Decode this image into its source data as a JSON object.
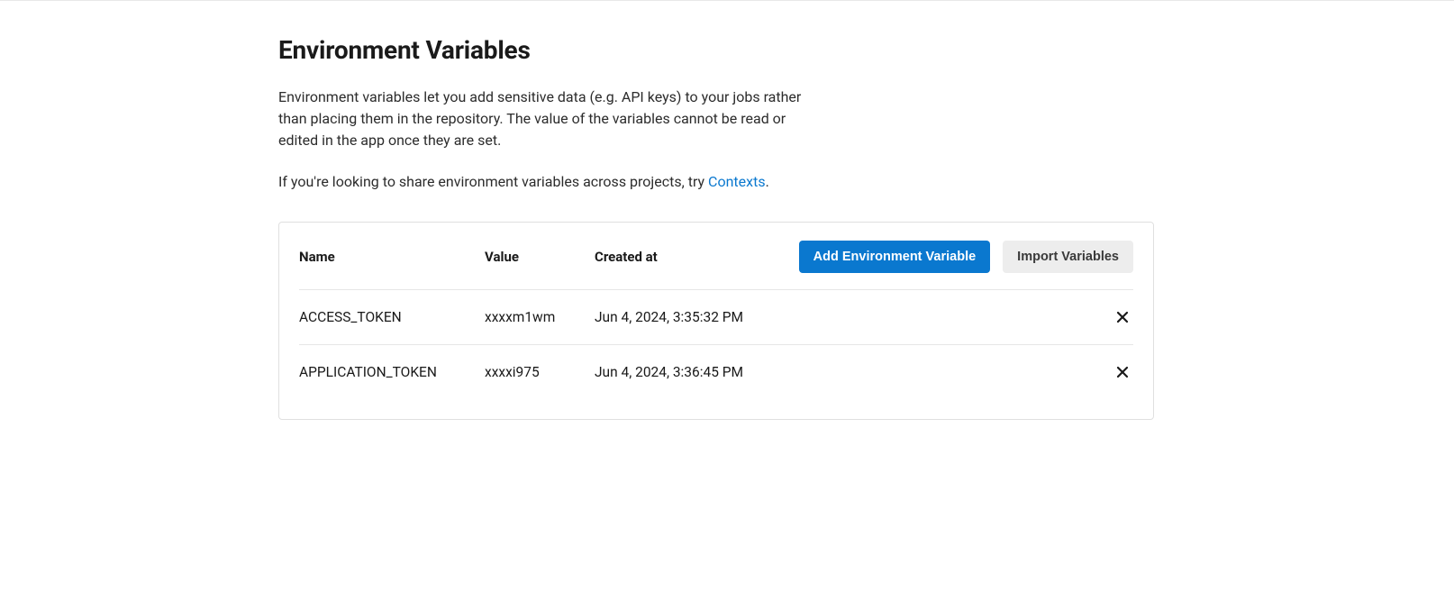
{
  "header": {
    "title": "Environment Variables"
  },
  "description": "Environment variables let you add sensitive data (e.g. API keys) to your jobs rather than placing them in the repository. The value of the variables cannot be read or edited in the app once they are set.",
  "contexts_line": {
    "prefix": "If you're looking to share environment variables across projects, try ",
    "link_label": "Contexts",
    "suffix": "."
  },
  "table": {
    "columns": {
      "name": "Name",
      "value": "Value",
      "created": "Created at"
    },
    "actions": {
      "add_label": "Add Environment Variable",
      "import_label": "Import Variables"
    },
    "rows": [
      {
        "name": "ACCESS_TOKEN",
        "value": "xxxxm1wm",
        "created": "Jun 4, 2024, 3:35:32 PM"
      },
      {
        "name": "APPLICATION_TOKEN",
        "value": "xxxxi975",
        "created": "Jun 4, 2024, 3:36:45 PM"
      }
    ]
  },
  "colors": {
    "primary": "#0a78cf",
    "border": "#e0e0e0",
    "text": "#1a1a1a"
  }
}
